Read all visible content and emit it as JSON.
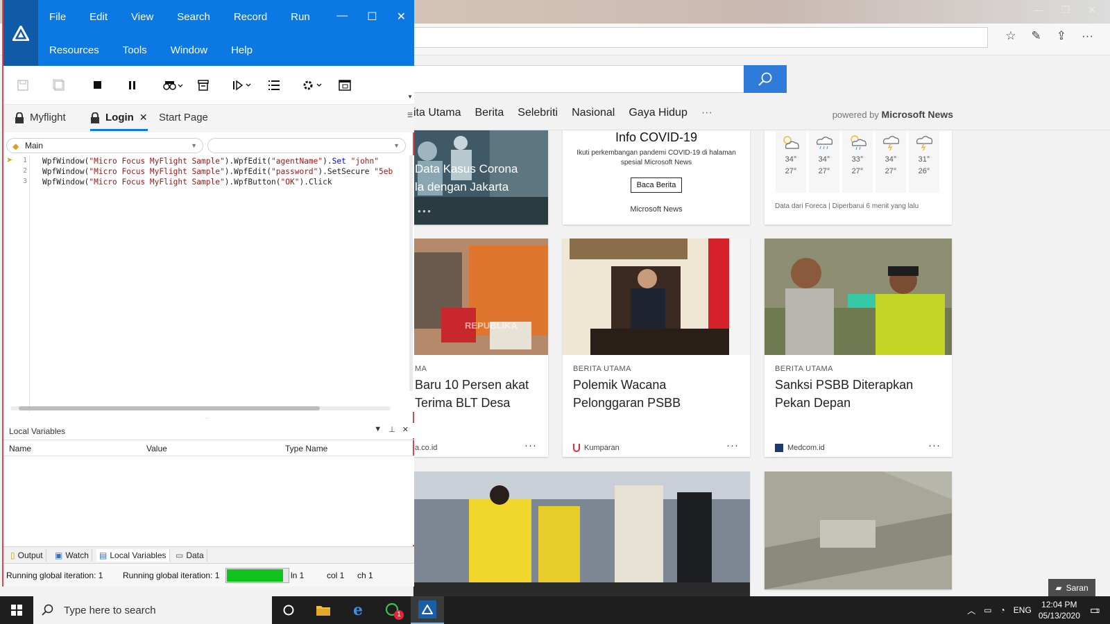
{
  "browser": {
    "nav": [
      "ita Utama",
      "Berita",
      "Selebriti",
      "Nasional",
      "Gaya Hidup",
      "···"
    ],
    "powered_prefix": "powered by",
    "powered_brand": "Microsoft News",
    "hero_text_1": "Data Kasus Corona",
    "hero_text_2": "la dengan Jakarta",
    "covid": {
      "title": "Info COVID-19",
      "body": "Ikuti perkembangan pandemi COVID-19 di halaman spesial Microsoft News",
      "cta": "Baca Berita",
      "brand": "Microsoft News"
    },
    "weather": {
      "days": [
        {
          "hi": "34°",
          "lo": "27°",
          "icon": "partly-sunny-icon"
        },
        {
          "hi": "34°",
          "lo": "27°",
          "icon": "rain-cloud-icon"
        },
        {
          "hi": "33°",
          "lo": "27°",
          "icon": "sun-rain-icon"
        },
        {
          "hi": "34°",
          "lo": "27°",
          "icon": "thunderstorm-icon"
        },
        {
          "hi": "31°",
          "lo": "26°",
          "icon": "thunderstorm-icon"
        }
      ],
      "footer": "Data dari Foreca | Diperbarui 6 menit yang lalu"
    },
    "cards": [
      {
        "category": "MA",
        "title": "Baru 10 Persen akat Terima BLT Desa",
        "source": "a.co.id",
        "watermark": "REPUBLIKA"
      },
      {
        "category": "BERITA UTAMA",
        "title": "Polemik Wacana Pelonggaran PSBB",
        "source": "Kumparan"
      },
      {
        "category": "BERITA UTAMA",
        "title": "Sanksi PSBB Diterapkan Pekan Depan",
        "source": "Medcom.id"
      }
    ],
    "more": "···",
    "saran": "Saran"
  },
  "uft": {
    "menu_row1": [
      "File",
      "Edit",
      "View",
      "Search",
      "Record",
      "Run"
    ],
    "menu_row2": [
      "Resources",
      "Tools",
      "Window",
      "Help"
    ],
    "tabs": [
      {
        "label": "Myflight"
      },
      {
        "label": "Login"
      },
      {
        "label": "Start Page"
      }
    ],
    "action_selector": "Main",
    "code": [
      {
        "n": "1",
        "a": "WpfWindow(",
        "s1": "\"Micro Focus MyFlight Sample\"",
        "b": ").WpfEdit(",
        "s2": "\"agentName\"",
        "c": ").",
        "kw": "Set",
        "d": " ",
        "s3": "\"john\""
      },
      {
        "n": "2",
        "a": "WpfWindow(",
        "s1": "\"Micro Focus MyFlight Sample\"",
        "b": ").WpfEdit(",
        "s2": "\"password\"",
        "c": ").SetSecure ",
        "kw": "",
        "d": "",
        "s3": "\"5eb"
      },
      {
        "n": "3",
        "a": "WpfWindow(",
        "s1": "\"Micro Focus MyFlight Sample\"",
        "b": ").WpfButton(",
        "s2": "\"OK\"",
        "c": ").Click",
        "kw": "",
        "d": "",
        "s3": ""
      }
    ],
    "panel_title": "Local Variables",
    "columns": [
      "Name",
      "Value",
      "Type Name"
    ],
    "bottom_tabs": [
      "Output",
      "Watch",
      "Local Variables",
      "Data"
    ],
    "status": {
      "left": "Running global iteration: 1",
      "mid": "Running global iteration: 1",
      "progress": 0.92,
      "ln": "ln 1",
      "col": "col 1",
      "ch": "ch 1"
    }
  },
  "taskbar": {
    "search_placeholder": "Type here to search",
    "whatsapp_badge": "1",
    "lang": "ENG",
    "time": "12:04 PM",
    "date": "05/13/2020",
    "notif_badge": "1"
  },
  "colors": {
    "uft_blue": "#0b78e3",
    "uft_border": "#e0434d",
    "search_blue": "#2f7bd9",
    "progress_green": "#10c31c"
  }
}
